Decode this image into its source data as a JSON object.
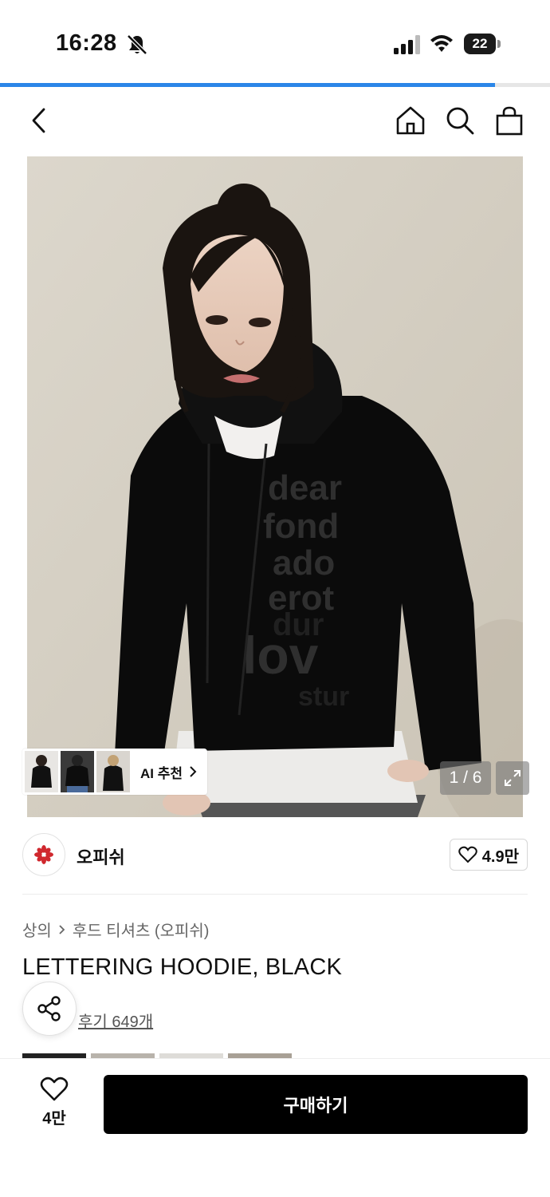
{
  "status_bar": {
    "time": "16:28",
    "battery": "22"
  },
  "progress": {
    "fraction": 0.9
  },
  "nav": {
    "back_icon": "chevron-left-icon",
    "home_icon": "home-icon",
    "search_icon": "search-icon",
    "cart_icon": "shopping-bag-icon"
  },
  "product_image": {
    "hoodie_print": [
      "dear",
      "fond",
      "ado",
      "erot",
      "dur",
      "lov",
      "stur"
    ],
    "counter": "1 / 6",
    "ai_recommend_label": "AI 추천"
  },
  "brand": {
    "name": "오피쉬",
    "like_count": "4.9만",
    "accent": "#d0282e"
  },
  "breadcrumb": {
    "items": [
      "상의",
      "후드 티셔츠 (오피쉬)"
    ]
  },
  "product": {
    "title": "LETTERING HOODIE, BLACK",
    "reviews": "후기 649개"
  },
  "bottom_bar": {
    "wish_count": "4만",
    "buy_label": "구매하기"
  }
}
